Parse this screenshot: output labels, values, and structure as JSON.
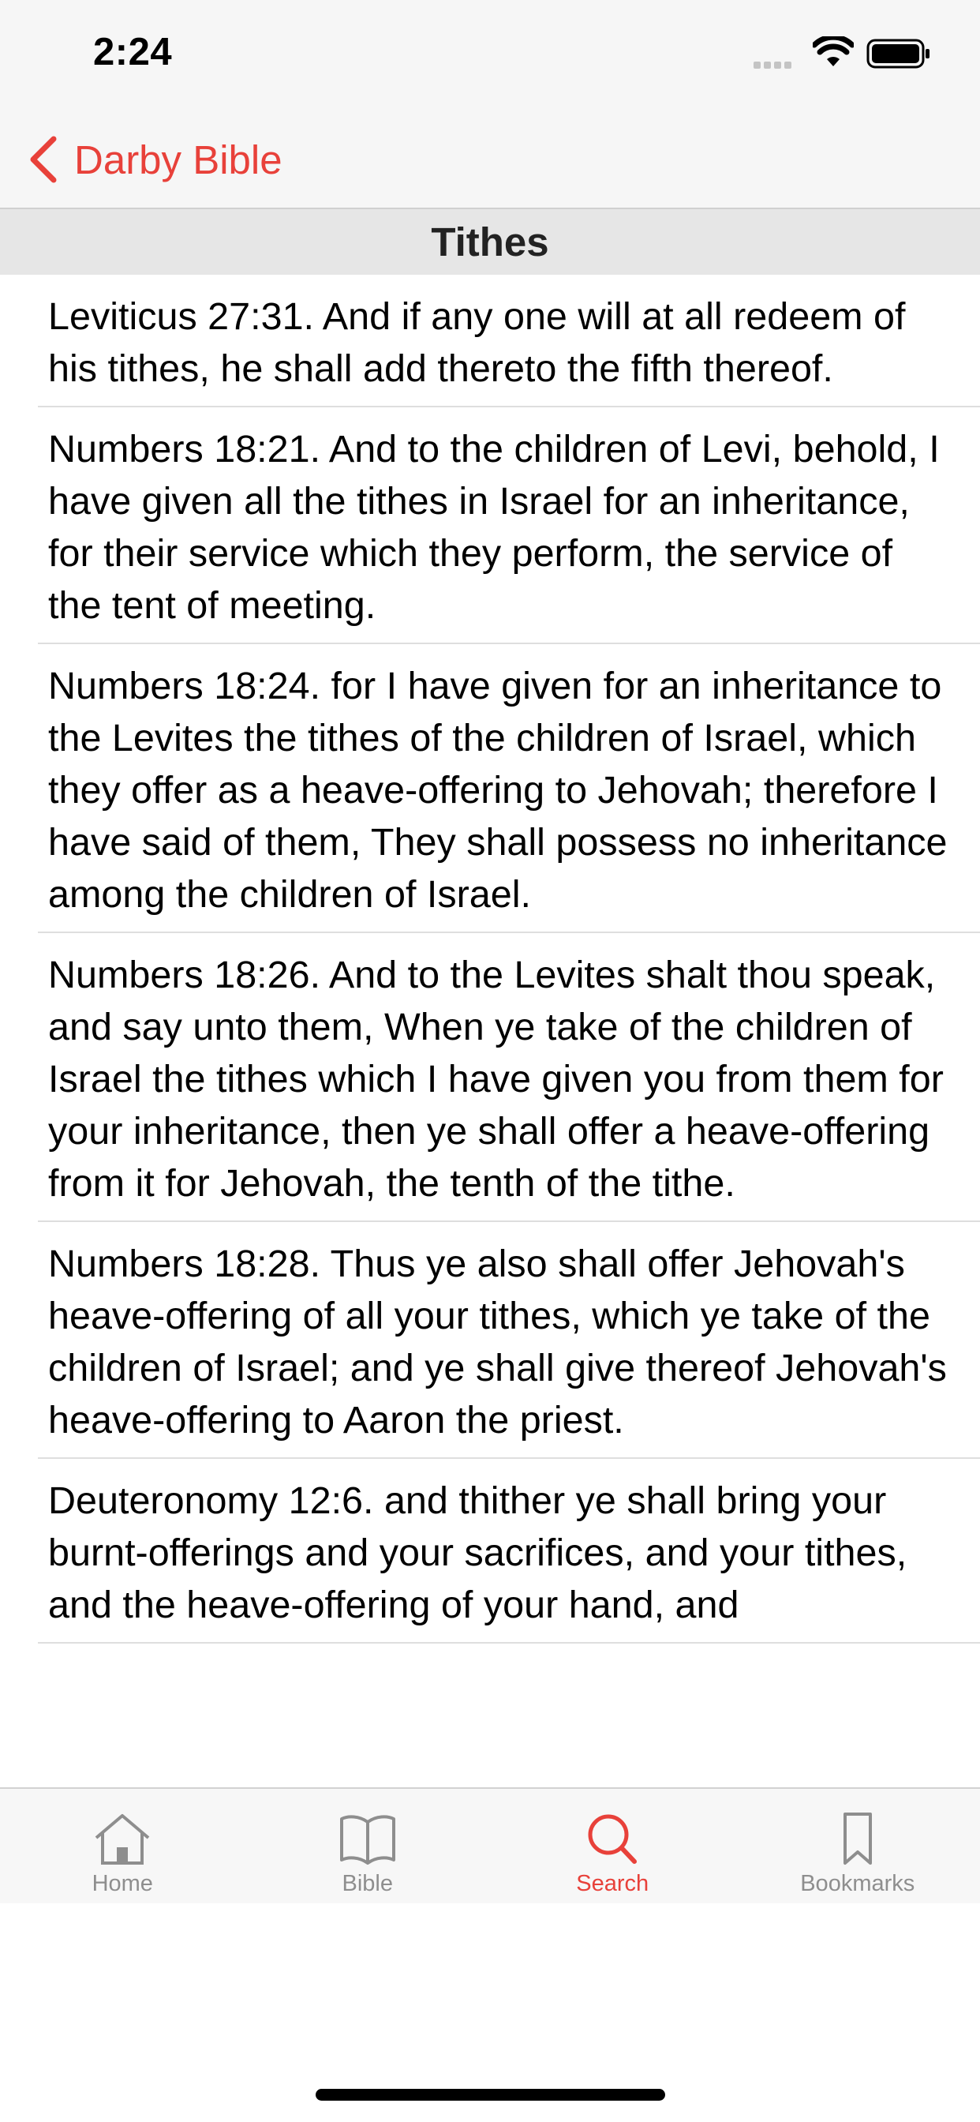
{
  "status_bar": {
    "time": "2:24"
  },
  "nav": {
    "back_label": "Darby Bible"
  },
  "section": {
    "title": "Tithes"
  },
  "verses": [
    "Leviticus 27:31. And if any one will at all redeem of his tithes, he shall add thereto the fifth thereof.",
    "Numbers 18:21. And to the children of Levi, behold, I have given all the tithes in Israel for an inheritance, for their service which they perform, the service of the tent of meeting.",
    "Numbers 18:24. for I have given for an inheritance to the Levites the tithes of the children of Israel, which they offer as a heave-offering to Jehovah; therefore I have said of them, They shall possess no inheritance among the children of Israel.",
    "Numbers 18:26. And to the Levites shalt thou speak, and say unto them, When ye take of the children of Israel the tithes which I have given you from them for your inheritance, then ye shall offer a heave-offering from it for Jehovah, the tenth of the tithe.",
    "Numbers 18:28. Thus ye also shall offer Jehovah's heave-offering of all your tithes, which ye take of the children of Israel; and ye shall give thereof Jehovah's heave-offering to Aaron the priest.",
    "Deuteronomy 12:6. and thither ye shall bring your burnt-offerings and your sacrifices, and your tithes, and the heave-offering of your hand, and"
  ],
  "tabs": [
    {
      "label": "Home",
      "icon": "home-icon",
      "active": false
    },
    {
      "label": "Bible",
      "icon": "book-icon",
      "active": false
    },
    {
      "label": "Search",
      "icon": "search-icon",
      "active": true
    },
    {
      "label": "Bookmarks",
      "icon": "bookmark-icon",
      "active": false
    }
  ],
  "colors": {
    "accent": "#e8413a",
    "inactive": "#8e8e8e",
    "bar_bg": "#f6f6f6",
    "header_bg": "#e6e6e6"
  }
}
